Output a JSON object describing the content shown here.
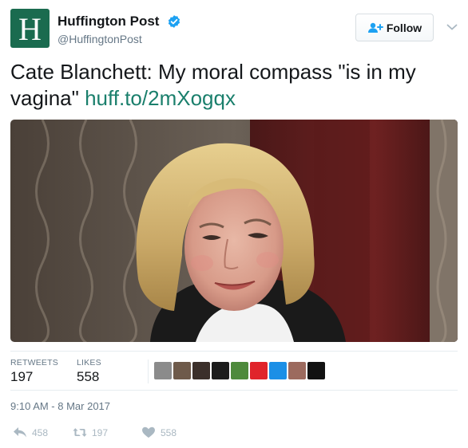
{
  "author": {
    "avatar_letter": "H",
    "name": "Huffington Post",
    "handle": "@HuffingtonPost",
    "avatar_color": "#1a6b4f",
    "verified_color": "#1da1f2"
  },
  "follow_button": {
    "label": "Follow",
    "icon": "follow-icon"
  },
  "tweet": {
    "text": "Cate Blanchett: My moral compass \"is in my vagina\" ",
    "link": "huff.to/2mXogqx",
    "link_color": "#1a7f6c"
  },
  "stats": {
    "retweets_label": "RETWEETS",
    "retweets": "197",
    "likes_label": "LIKES",
    "likes": "558"
  },
  "likers": [
    {
      "icon": "avatar-1",
      "color": "#8b8b8b"
    },
    {
      "icon": "avatar-2",
      "color": "#6e5a4a"
    },
    {
      "icon": "avatar-3",
      "color": "#3b2f2a"
    },
    {
      "icon": "avatar-4",
      "color": "#1c1c1c"
    },
    {
      "icon": "avatar-5",
      "color": "#4e8a3c"
    },
    {
      "icon": "avatar-6",
      "color": "#e0242b"
    },
    {
      "icon": "avatar-7",
      "color": "#1b8fe6"
    },
    {
      "icon": "avatar-8",
      "color": "#9c6a5e"
    },
    {
      "icon": "avatar-9",
      "color": "#121212"
    }
  ],
  "timestamp": "9:10 AM - 8 Mar 2017",
  "actions": {
    "replies": "458",
    "retweets": "197",
    "likes": "558"
  }
}
